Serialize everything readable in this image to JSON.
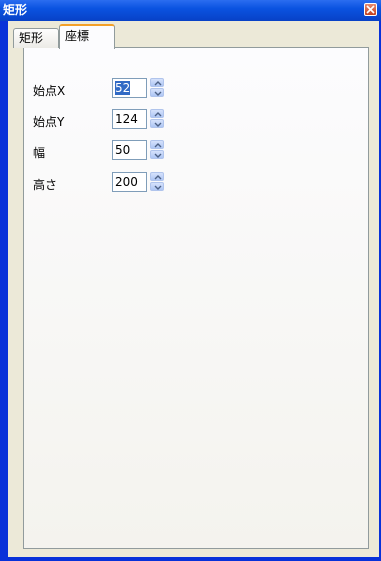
{
  "window": {
    "title": "矩形"
  },
  "tabs": [
    {
      "label": "矩形",
      "active": false
    },
    {
      "label": "座標",
      "active": true
    }
  ],
  "fields": [
    {
      "label": "始点X",
      "value": "52",
      "selected": true
    },
    {
      "label": "始点Y",
      "value": "124",
      "selected": false
    },
    {
      "label": "幅",
      "value": "50",
      "selected": false
    },
    {
      "label": "高さ",
      "value": "200",
      "selected": false
    }
  ],
  "colors": {
    "titlebar": "#0a53e1",
    "frame": "#0831d9",
    "tab_highlight": "#f3a028",
    "selection": "#316ac5"
  },
  "icons": {
    "close": "close-icon",
    "spin_up": "chevron-up-icon",
    "spin_down": "chevron-down-icon"
  }
}
